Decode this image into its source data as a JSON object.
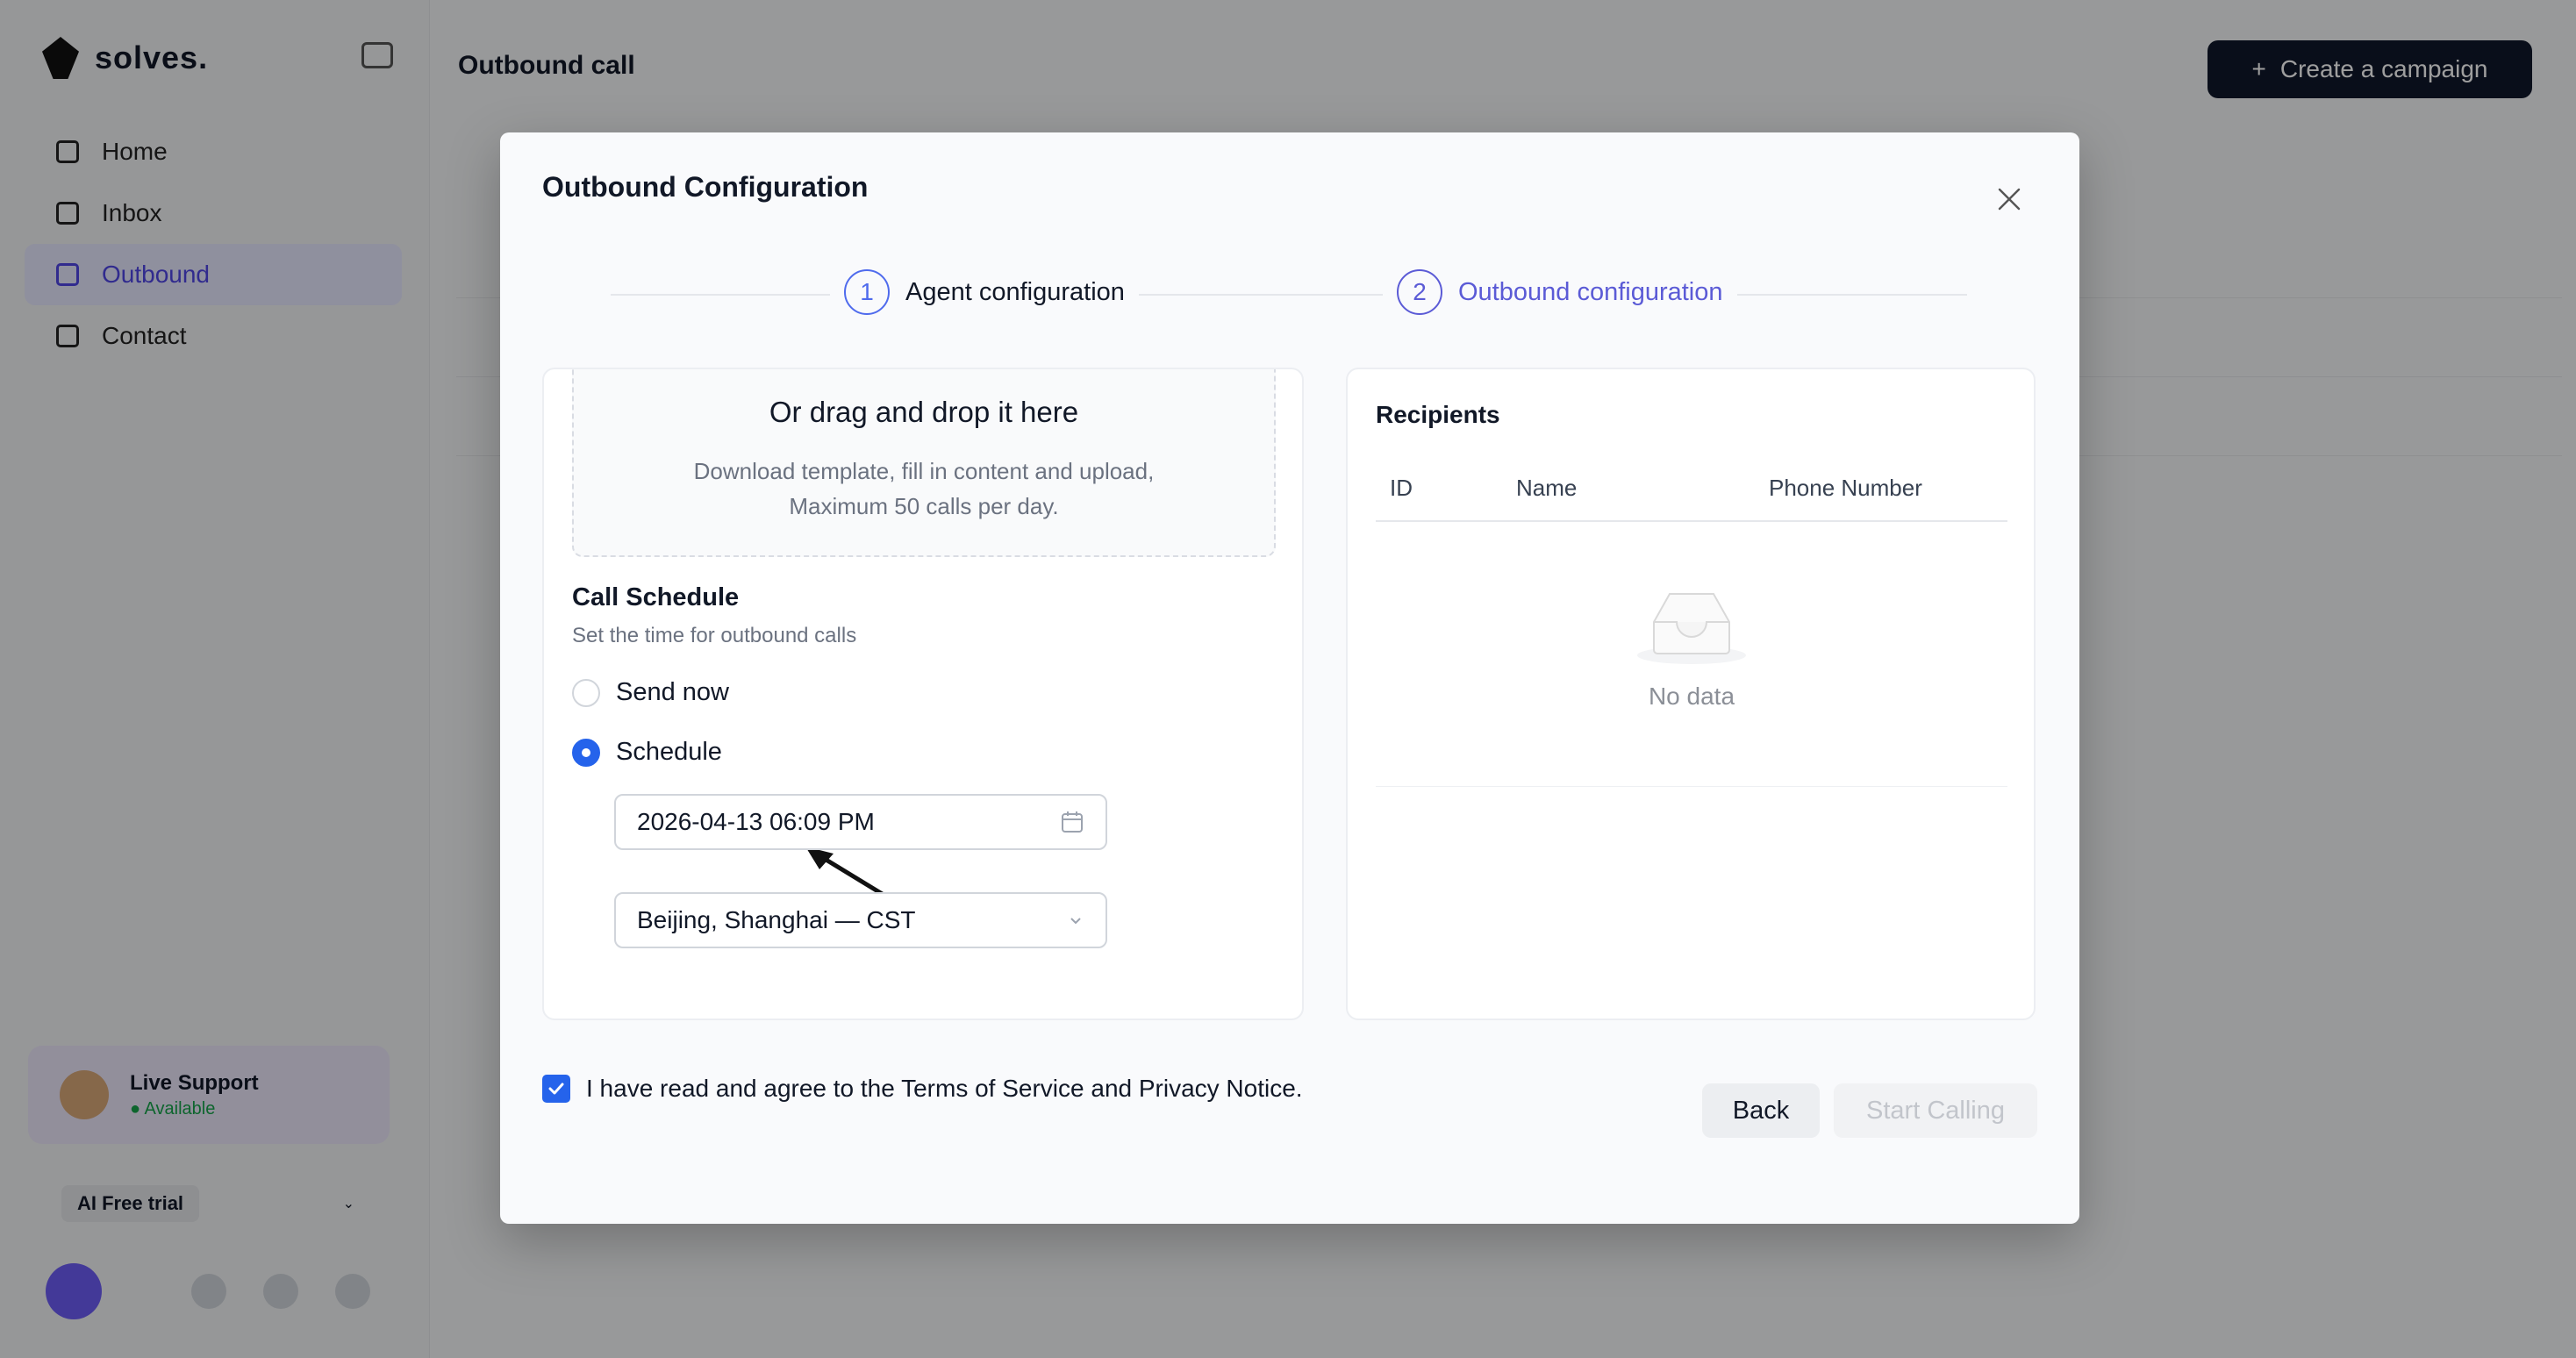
{
  "app": {
    "logo_text": "solves.",
    "page_title": "Outbound call",
    "create_button": "Create a campaign",
    "nav": [
      {
        "label": "Home"
      },
      {
        "label": "Inbox"
      },
      {
        "label": "Outbound"
      },
      {
        "label": "Contact"
      }
    ],
    "support": {
      "title": "Live Support",
      "status": "● Available"
    },
    "plan_label": "AI Free trial"
  },
  "modal": {
    "title": "Outbound Configuration",
    "steps": [
      {
        "number": "1",
        "label": "Agent configuration"
      },
      {
        "number": "2",
        "label": "Outbound configuration"
      }
    ],
    "dropzone": {
      "title": "Or drag and drop it here",
      "desc_line1": "Download template, fill in content and upload,",
      "desc_line2": "Maximum 50 calls per day."
    },
    "schedule": {
      "title": "Call Schedule",
      "subtitle": "Set the time for outbound calls",
      "option_now": "Send now",
      "option_schedule": "Schedule",
      "selected": "Schedule",
      "datetime_value": "2026-04-13 06:09 PM",
      "timezone_value": "Beijing, Shanghai — CST"
    },
    "recipients": {
      "title": "Recipients",
      "columns": [
        "ID",
        "Name",
        "Phone Number"
      ],
      "empty_text": "No data"
    },
    "agree_text": "I have read and agree to the Terms of Service and Privacy Notice.",
    "back_button": "Back",
    "start_button": "Start Calling"
  },
  "colors": {
    "accent": "#5b5bd6",
    "primary_blue": "#2563eb"
  }
}
